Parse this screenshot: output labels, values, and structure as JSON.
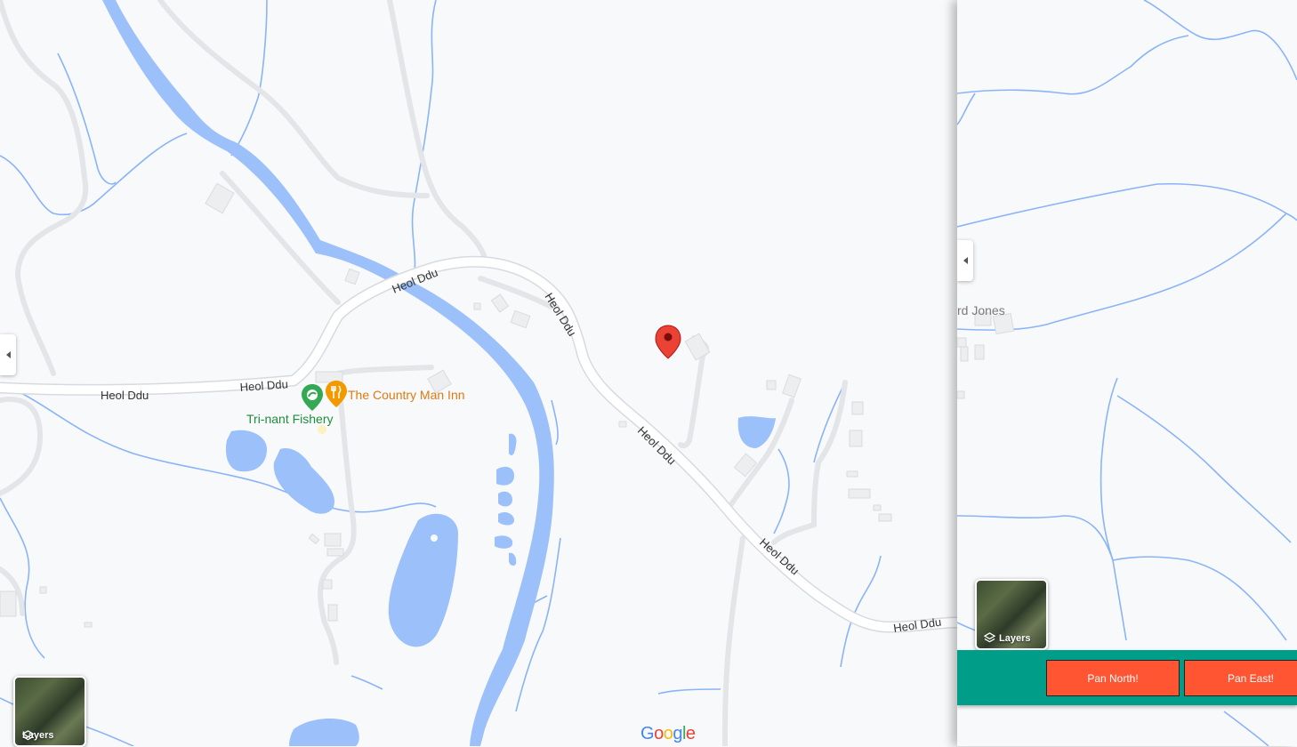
{
  "map": {
    "road_labels": [
      "Heol Ddu",
      "Heol Ddu",
      "Heol Ddu",
      "Heol Ddu",
      "Heol Ddu",
      "Heol Ddu",
      "Heol Ddu"
    ],
    "pois": {
      "restaurant": "The Country Man Inn",
      "fishery": "Tri-nant Fishery"
    },
    "marker_icon": "red-location-pin-icon",
    "attribution": {
      "letters": [
        "G",
        "o",
        "o",
        "g",
        "l",
        "e"
      ],
      "colors": [
        "#4285F4",
        "#EA4335",
        "#FBBC05",
        "#4285F4",
        "#34A853",
        "#EA4335"
      ]
    },
    "layers_label": "Layers"
  },
  "side_panel": {
    "faded_label": "rd Jones",
    "layers_label": "Layers",
    "toolbar": {
      "pan_north": "Pan North!",
      "pan_east": "Pan East!"
    }
  },
  "colors": {
    "water": "#9cc0fa",
    "stream": "#8ab4f8",
    "land": "#f8f9fa",
    "road": "#ffffff",
    "toolbar": "#009e89",
    "pan_button": "#ff5533"
  }
}
